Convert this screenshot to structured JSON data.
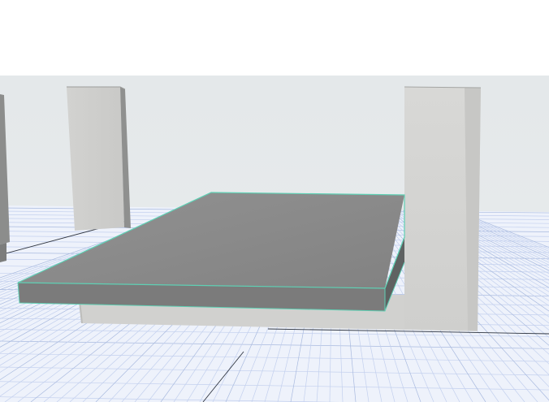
{
  "app": {
    "view": "3D view"
  },
  "colors": {
    "background": "#ffffff",
    "sky": "#e6eaeb",
    "ground": "#eef2fb",
    "grid_minor": "#c3d0ee",
    "grid_major": "#a9badf",
    "grid_axis": "#2f3540",
    "slab_top": "#8e8e8e",
    "slab_front": "#7a7a7a",
    "slab_side": "#5f6262",
    "wall_face": "#d3d3d1",
    "wall_side": "#8f908f",
    "selection_outline": "#5fd0b4"
  },
  "scene": {
    "objects": [
      {
        "kind": "column",
        "name": "left-column"
      },
      {
        "kind": "wall",
        "name": "right-wall"
      },
      {
        "kind": "slab",
        "name": "floor-slab",
        "selected": true
      },
      {
        "kind": "column",
        "name": "edge-column"
      }
    ],
    "grid": "on"
  }
}
